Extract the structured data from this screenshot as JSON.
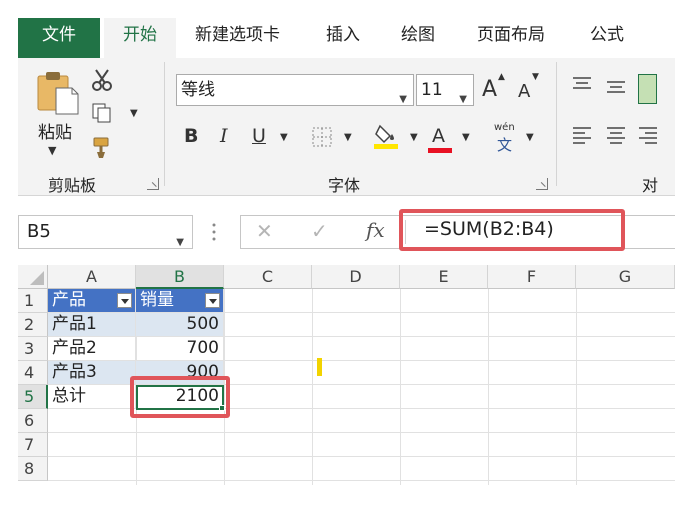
{
  "ribbon_tabs": [
    "文件",
    "开始",
    "新建选项卡",
    "插入",
    "绘图",
    "页面布局",
    "公式"
  ],
  "ribbon": {
    "clipboard": {
      "paste_label": "粘贴",
      "group_label": "剪贴板"
    },
    "font": {
      "font_name": "等线",
      "font_size": "11",
      "grow_label": "A",
      "shrink_label": "A",
      "bold_label": "B",
      "italic_label": "I",
      "underline_label": "U",
      "font_color_label": "A",
      "phonetic_top": "wén",
      "phonetic_bottom": "文",
      "group_label": "字体",
      "highlight_color": "#ffe600",
      "font_color": "#e81123"
    },
    "alignment_group_partial": "对"
  },
  "formula_bar": {
    "name_box": "B5",
    "cancel_glyph": "✕",
    "enter_glyph": "✓",
    "fx_label": "fx",
    "formula": "=SUM(B2:B4)"
  },
  "grid": {
    "columns": [
      "A",
      "B",
      "C",
      "D",
      "E",
      "F",
      "G"
    ],
    "rows": [
      "1",
      "2",
      "3",
      "4",
      "5",
      "6",
      "7",
      "8"
    ],
    "table": {
      "header": [
        "产品",
        "销量"
      ],
      "rows": [
        [
          "产品1",
          "500"
        ],
        [
          "产品2",
          "700"
        ],
        [
          "产品3",
          "900"
        ]
      ],
      "total": [
        "总计",
        "2100"
      ]
    },
    "active_cell": "B5"
  },
  "colors": {
    "accent_green": "#217346",
    "table_header_blue": "#4472c4",
    "table_band": "#dce6f1",
    "annotation_red": "#e0555a"
  }
}
